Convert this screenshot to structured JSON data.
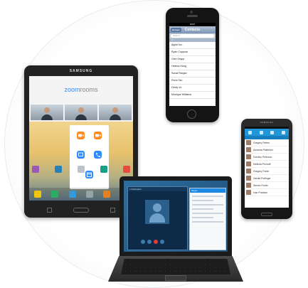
{
  "tablet": {
    "brand": "SAMSUNG",
    "app_logo": {
      "zoom": "zoom",
      "rooms": "rooms"
    }
  },
  "iphone": {
    "status_text": "AT&T",
    "nav_title": "Contacts",
    "back_label": "Groups",
    "search_placeholder": "Search",
    "section_header": "A",
    "contacts": [
      "Apple Inc.",
      "Ryan Coppola",
      "Clee Grapp",
      "Helena Hung",
      "Sonal Ranjan",
      "Porto Tao",
      "Cindy Vo",
      "Monique Williams"
    ]
  },
  "galaxy": {
    "brand": "SAMSUNG",
    "contacts": [
      "Gregory Peters",
      "Amanda Patterson",
      "Dorothy Peterson",
      "Melinda Pennoff",
      "Gregory Porter",
      "Gerald Pottinger",
      "Steven Porter",
      "Ivan Powlson"
    ]
  },
  "laptop": {
    "call_title": "1 Participant",
    "chat_title": "Skype"
  },
  "colors": {
    "zoom_blue": "#2d8cff",
    "zoom_orange": "#ff8a1d",
    "android_blue": "#2196d9",
    "call_end_red": "#e53935"
  }
}
